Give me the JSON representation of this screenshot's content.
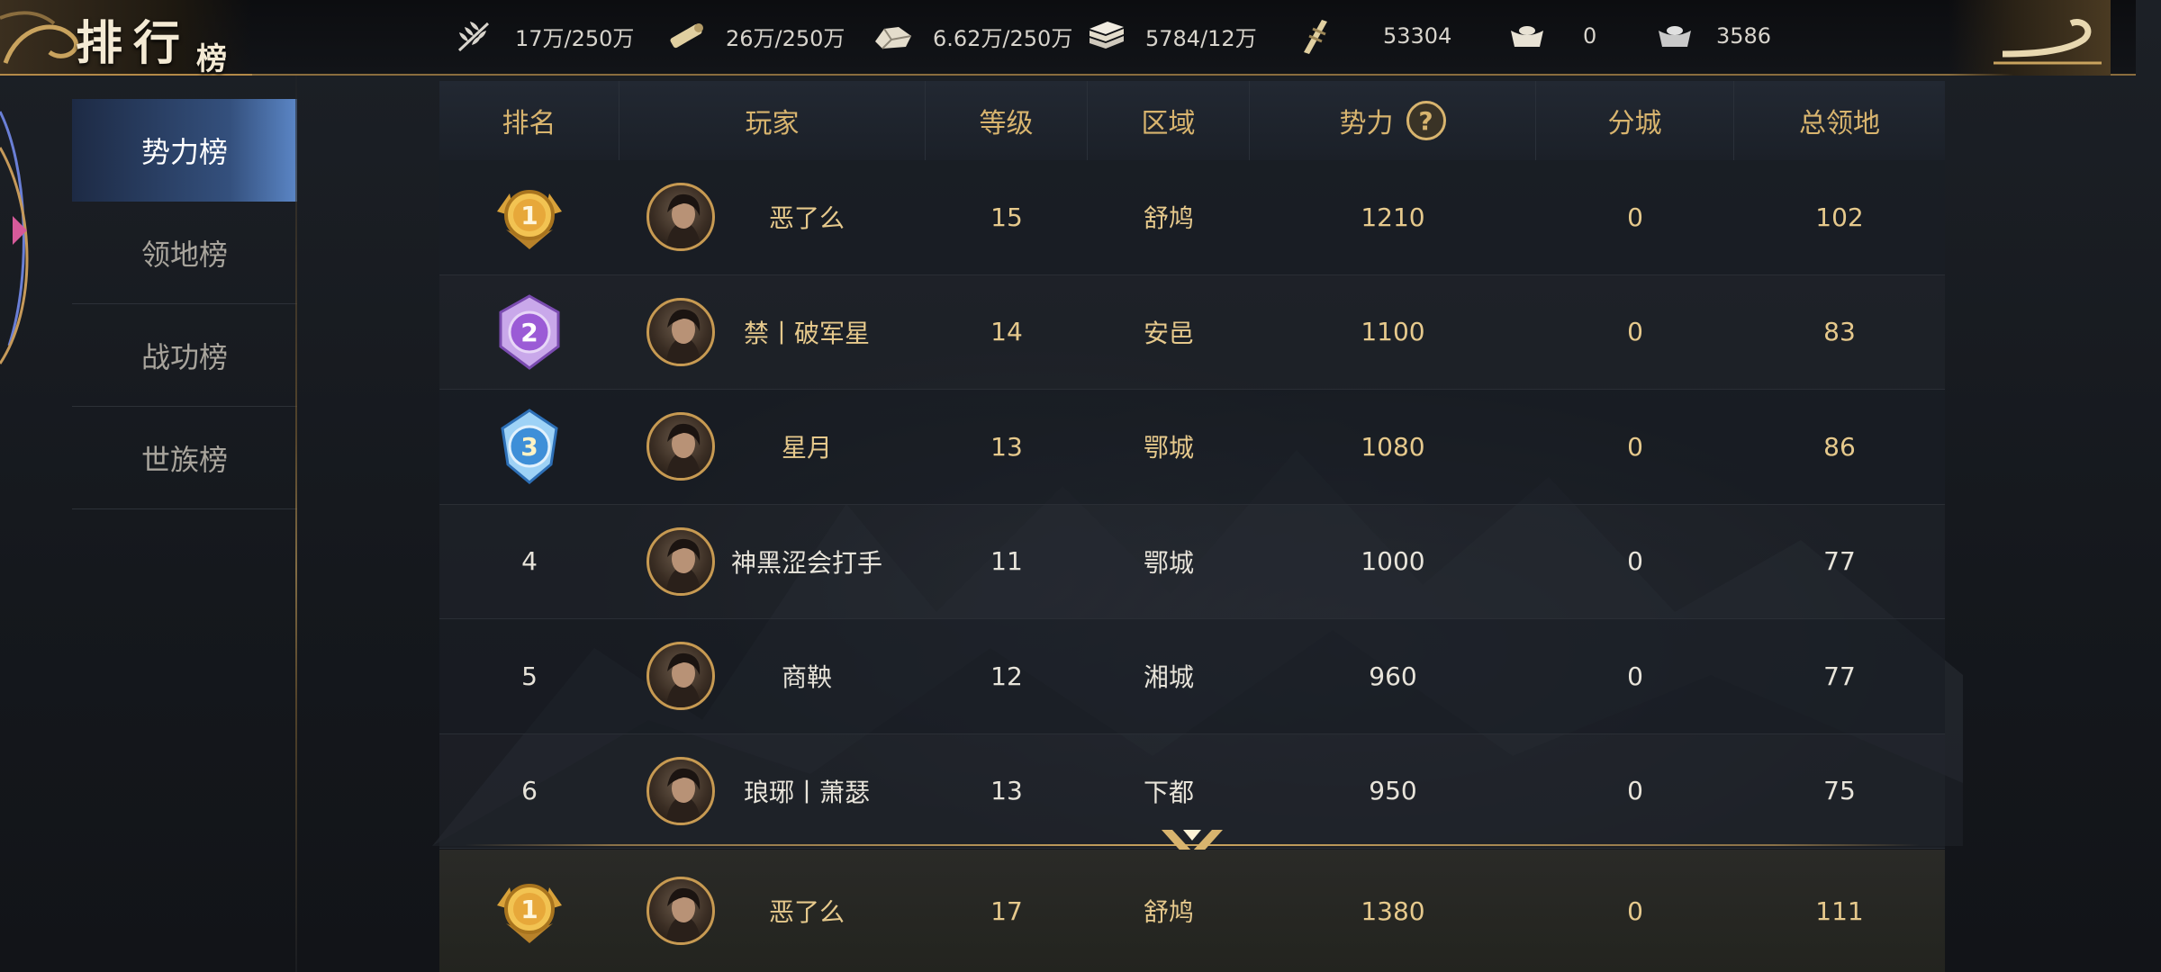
{
  "header": {
    "title": "排行",
    "title_sub": "榜",
    "resources": [
      {
        "icon": "grain-icon",
        "value": "17万/250万"
      },
      {
        "icon": "wood-icon",
        "value": "26万/250万"
      },
      {
        "icon": "stone-icon",
        "value": "6.62万/250万"
      },
      {
        "icon": "iron-icon",
        "value": "5784/12万"
      },
      {
        "icon": "decree-icon",
        "value": "53304"
      },
      {
        "icon": "gold-ingot-icon",
        "value": "0"
      },
      {
        "icon": "silver-ingot-icon",
        "value": "3586"
      }
    ]
  },
  "sidebar": {
    "items": [
      {
        "label": "势力榜",
        "active": true
      },
      {
        "label": "领地榜",
        "active": false
      },
      {
        "label": "战功榜",
        "active": false
      },
      {
        "label": "世族榜",
        "active": false
      }
    ]
  },
  "table": {
    "columns": [
      "排名",
      "玩家",
      "等级",
      "区域",
      "势力",
      "分城",
      "总领地"
    ],
    "rows": [
      {
        "rank": "1",
        "player": "恶了么",
        "level": "15",
        "region": "舒鸠",
        "power": "1210",
        "cities": "0",
        "land": "102"
      },
      {
        "rank": "2",
        "player": "禁丨破军星",
        "level": "14",
        "region": "安邑",
        "power": "1100",
        "cities": "0",
        "land": "83"
      },
      {
        "rank": "3",
        "player": "星月",
        "level": "13",
        "region": "鄂城",
        "power": "1080",
        "cities": "0",
        "land": "86"
      },
      {
        "rank": "4",
        "player": "神黑涩会打手",
        "level": "11",
        "region": "鄂城",
        "power": "1000",
        "cities": "0",
        "land": "77"
      },
      {
        "rank": "5",
        "player": "商鞅",
        "level": "12",
        "region": "湘城",
        "power": "960",
        "cities": "0",
        "land": "77"
      },
      {
        "rank": "6",
        "player": "琅琊丨萧瑟",
        "level": "13",
        "region": "下都",
        "power": "950",
        "cities": "0",
        "land": "75"
      }
    ]
  },
  "my_rank": {
    "rank": "1",
    "player": "恶了么",
    "level": "17",
    "region": "舒鸠",
    "power": "1380",
    "cities": "0",
    "land": "111"
  },
  "colors": {
    "gold_text": "#d8b46e",
    "active_tab": "#5b86c6",
    "medal_gold": "#e0a93a",
    "medal_purple": "#9b5bd6",
    "medal_blue": "#3e8fd8"
  }
}
